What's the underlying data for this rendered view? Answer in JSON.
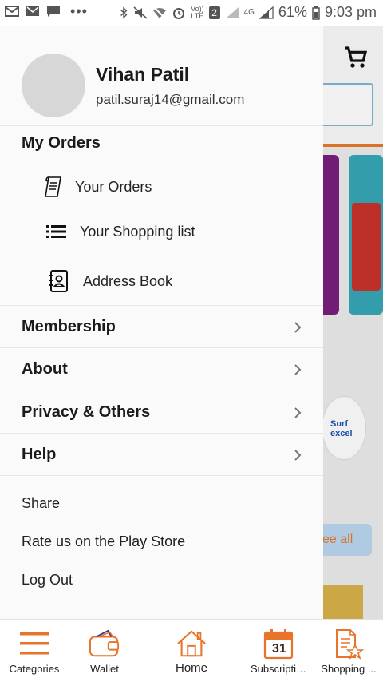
{
  "status_bar": {
    "battery_percent": "61%",
    "time": "9:03 pm",
    "sim_badge": "2",
    "network_label": "4G",
    "volte_label_top": "Vo))",
    "volte_label_bottom": "LTE"
  },
  "profile": {
    "name": "Vihan Patil",
    "email": "patil.suraj14@gmail.com"
  },
  "my_orders": {
    "title": "My Orders",
    "items": [
      {
        "label": "Your Orders",
        "icon": "receipt-icon"
      },
      {
        "label": "Your Shopping list",
        "icon": "list-icon"
      },
      {
        "label": "Address Book",
        "icon": "contacts-book-icon"
      }
    ]
  },
  "menu_rows": [
    {
      "label": "Membership"
    },
    {
      "label": "About"
    },
    {
      "label": "Privacy & Others"
    },
    {
      "label": "Help"
    }
  ],
  "plain_items": [
    {
      "label": "Share"
    },
    {
      "label": "Rate us on the Play Store"
    },
    {
      "label": "Log Out"
    }
  ],
  "background": {
    "see_all_fragment": "ee all",
    "brand_fragment": "Surf excel"
  },
  "bottom_nav": {
    "items": [
      {
        "label": "Categories",
        "icon": "hamburger-icon"
      },
      {
        "label": "Wallet",
        "icon": "wallet-icon"
      },
      {
        "label": "Home",
        "icon": "home-icon"
      },
      {
        "label": "Subscripti…",
        "icon": "calendar-icon",
        "calendar_day": "31"
      },
      {
        "label": "Shopping ...",
        "icon": "shopping-list-icon"
      }
    ]
  },
  "colors": {
    "accent": "#e8732a",
    "drawer_bg": "#fafafa",
    "text_primary": "#1b1b1b"
  }
}
